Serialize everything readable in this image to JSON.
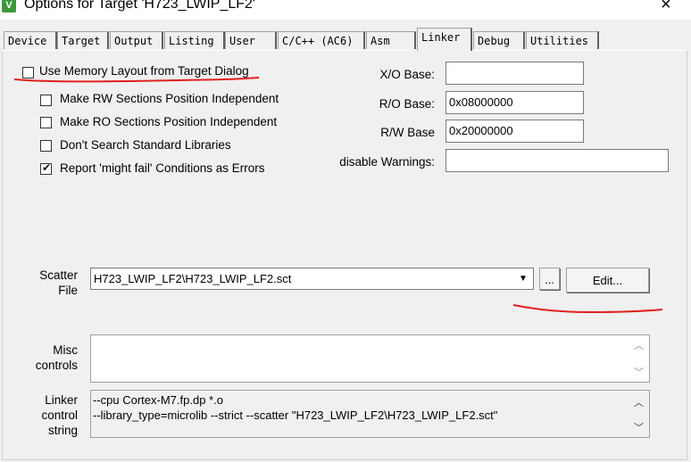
{
  "window": {
    "title": "Options for Target 'H723_LWIP_LF2'",
    "app_icon": "V",
    "close_icon": "×"
  },
  "tabs": [
    {
      "label": "Device"
    },
    {
      "label": "Target"
    },
    {
      "label": "Output"
    },
    {
      "label": "Listing"
    },
    {
      "label": "User"
    },
    {
      "label": "C/C++ (AC6)"
    },
    {
      "label": "Asm"
    },
    {
      "label": "Linker"
    },
    {
      "label": "Debug"
    },
    {
      "label": "Utilities"
    }
  ],
  "active_tab": "Linker",
  "options": {
    "use_memory_layout": {
      "label": "Use Memory Layout from Target Dialog",
      "checked": false
    },
    "rw_independent": {
      "label": "Make RW Sections Position Independent",
      "checked": false
    },
    "ro_independent": {
      "label": "Make RO Sections Position Independent",
      "checked": false
    },
    "no_std_libs": {
      "label": "Don't Search Standard Libraries",
      "checked": false
    },
    "might_fail": {
      "label": "Report 'might fail' Conditions as Errors",
      "checked": true,
      "check_glyph": "✔"
    }
  },
  "bases": {
    "xo_label": "X/O Base:",
    "xo_value": "",
    "ro_label": "R/O Base:",
    "ro_value": "0x08000000",
    "rw_label": "R/W Base",
    "rw_value": "0x20000000",
    "warnings_label": "disable Warnings:",
    "warnings_value": ""
  },
  "scatter": {
    "label_line1": "Scatter",
    "label_line2": "File",
    "value": "H723_LWIP_LF2\\H723_LWIP_LF2.sct",
    "dropdown_glyph": "▼",
    "browse_label": "...",
    "edit_label": "Edit..."
  },
  "misc": {
    "label_line1": "Misc",
    "label_line2": "controls",
    "value": ""
  },
  "linker_control": {
    "label_line1": "Linker",
    "label_line2": "control",
    "label_line3": "string",
    "line1": "--cpu Cortex-M7.fp.dp *.o",
    "line2": "--library_type=microlib --strict --scatter \"H723_LWIP_LF2\\H723_LWIP_LF2.sct\""
  },
  "scroll": {
    "up_glyph": "︿",
    "down_glyph": "﹀"
  },
  "annotation_color": "#e02020"
}
